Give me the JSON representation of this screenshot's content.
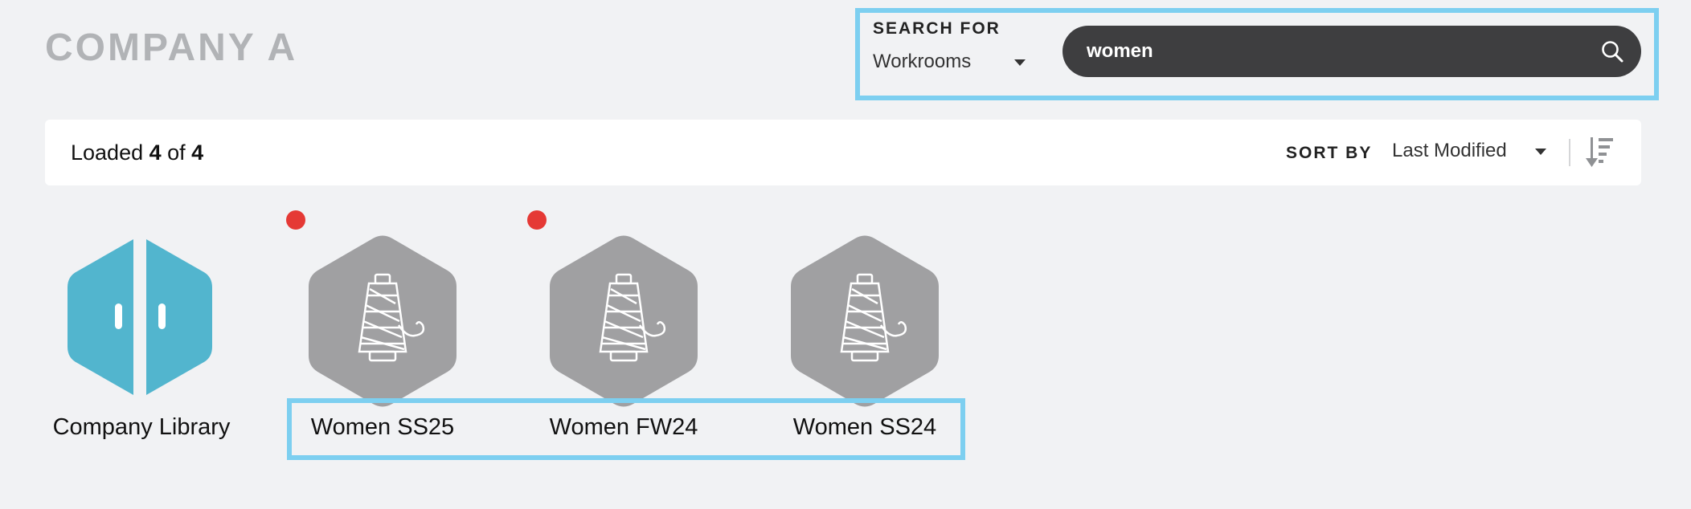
{
  "header": {
    "brand": "COMPANY A"
  },
  "search": {
    "label": "SEARCH FOR",
    "type_selected": "Workrooms",
    "query": "women"
  },
  "toolbar": {
    "loaded_prefix": "Loaded ",
    "loaded_count": "4",
    "loaded_mid": " of ",
    "loaded_total": "4",
    "sort_label": "SORT BY",
    "sort_selected": "Last Modified"
  },
  "tiles": [
    {
      "label": "Company Library",
      "icon": "company-library-icon",
      "unread": false
    },
    {
      "label": "Women SS25",
      "icon": "thread-spool-icon",
      "unread": true
    },
    {
      "label": "Women FW24",
      "icon": "thread-spool-icon",
      "unread": true
    },
    {
      "label": "Women SS24",
      "icon": "thread-spool-icon",
      "unread": false
    }
  ],
  "colors": {
    "library_hex": "#52b5ce",
    "workroom_hex": "#a0a0a2",
    "unread_badge": "#e53935",
    "highlight_outline": "#7dcff0",
    "search_bar": "#3e3e40"
  }
}
